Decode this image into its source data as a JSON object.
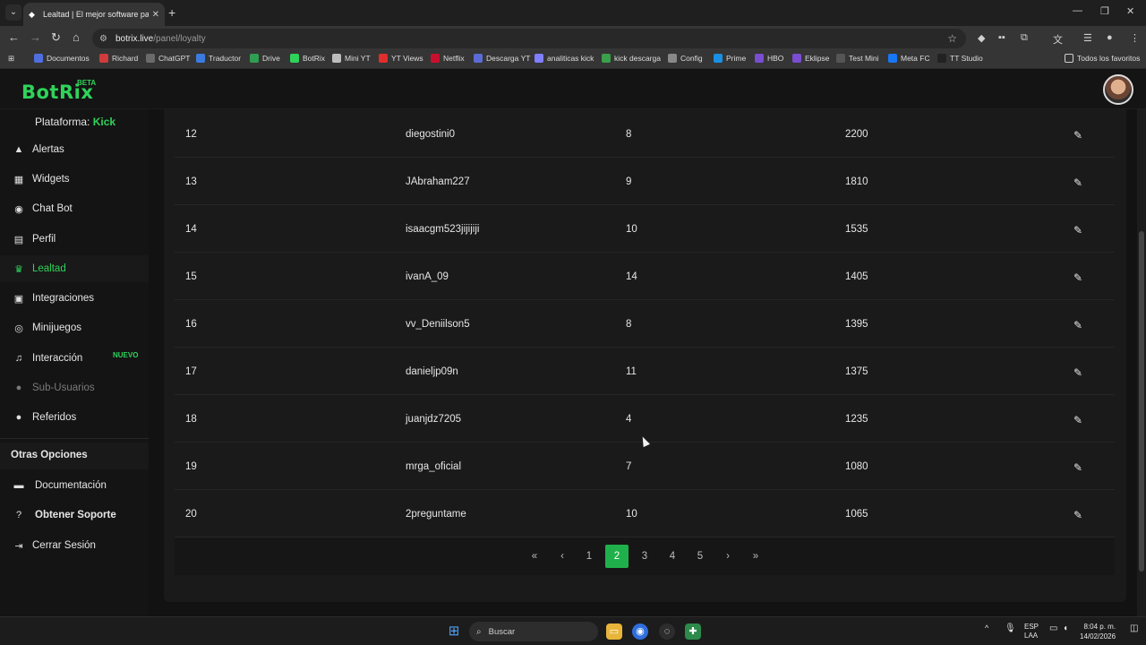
{
  "browser": {
    "tab_title": "Lealtad | El mejor software para",
    "url_host": "botrix.live",
    "url_path": "/panel/loyalty",
    "bookmarks": [
      {
        "label": "Documentos",
        "color": "#4f6fe0"
      },
      {
        "label": "Richard",
        "color": "#d13b3b"
      },
      {
        "label": "ChatGPT",
        "color": "#6a6a6a"
      },
      {
        "label": "Traductor",
        "color": "#3b7be0"
      },
      {
        "label": "Drive",
        "color": "#2f9e52"
      },
      {
        "label": "BotRix",
        "color": "#2fd35a"
      },
      {
        "label": "Mini YT",
        "color": "#bdbdbd"
      },
      {
        "label": "YT Views",
        "color": "#e02d2d"
      },
      {
        "label": "Netflix",
        "color": "#c8102e"
      },
      {
        "label": "Descarga YT",
        "color": "#5b6bd6"
      },
      {
        "label": "analiticas kick",
        "color": "#7f7fff"
      },
      {
        "label": "kick descarga",
        "color": "#3aa04a"
      },
      {
        "label": "Config",
        "color": "#888888"
      },
      {
        "label": "Prime",
        "color": "#1a8fe3"
      },
      {
        "label": "HBO",
        "color": "#7a4dd1"
      },
      {
        "label": "Eklipse",
        "color": "#7a4dd1"
      },
      {
        "label": "Test Mini",
        "color": "#555555"
      },
      {
        "label": "Meta FC",
        "color": "#1877f2"
      },
      {
        "label": "TT Studio",
        "color": "#222222"
      }
    ],
    "all_bookmarks_label": "Todos los favoritos"
  },
  "app": {
    "logo": "BotRix",
    "logo_beta": "BETA",
    "accent": "#2fd35a"
  },
  "sidebar": {
    "platform_label": "Plataforma:",
    "platform_value": "Kick",
    "items": [
      {
        "label": "Alertas",
        "icon": "warning-icon"
      },
      {
        "label": "Widgets",
        "icon": "grid-icon"
      },
      {
        "label": "Chat Bot",
        "icon": "robot-icon"
      },
      {
        "label": "Perfil",
        "icon": "id-card-icon"
      },
      {
        "label": "Lealtad",
        "icon": "trophy-icon"
      },
      {
        "label": "Integraciones",
        "icon": "cube-icon"
      },
      {
        "label": "Minijuegos",
        "icon": "gamepad-icon"
      },
      {
        "label": "Interacción",
        "icon": "music-icon"
      },
      {
        "label": "Sub-Usuarios",
        "icon": "users-icon"
      },
      {
        "label": "Referidos",
        "icon": "user-group-icon"
      }
    ],
    "nuevo_badge": "NUEVO",
    "other_section": "Otras Opciones",
    "other_items": [
      {
        "label": "Documentación",
        "icon": "scroll-icon"
      },
      {
        "label": "Obtener Soporte",
        "icon": "question-icon"
      },
      {
        "label": "Cerrar Sesión",
        "icon": "sign-out-icon"
      }
    ]
  },
  "table": {
    "rows": [
      {
        "rank": "12",
        "user": "diegostini0",
        "level": "8",
        "points": "2200"
      },
      {
        "rank": "13",
        "user": "JAbraham227",
        "level": "9",
        "points": "1810"
      },
      {
        "rank": "14",
        "user": "isaacgm523jijijiji",
        "level": "10",
        "points": "1535"
      },
      {
        "rank": "15",
        "user": "ivanA_09",
        "level": "14",
        "points": "1405"
      },
      {
        "rank": "16",
        "user": "vv_Deniilson5",
        "level": "8",
        "points": "1395"
      },
      {
        "rank": "17",
        "user": "danieljp09n",
        "level": "11",
        "points": "1375"
      },
      {
        "rank": "18",
        "user": "juanjdz7205",
        "level": "4",
        "points": "1235"
      },
      {
        "rank": "19",
        "user": "mrga_oficial",
        "level": "7",
        "points": "1080"
      },
      {
        "rank": "20",
        "user": "2preguntame",
        "level": "10",
        "points": "1065"
      }
    ]
  },
  "pagination": {
    "first": "«",
    "prev": "‹",
    "pages": [
      "1",
      "2",
      "3",
      "4",
      "5"
    ],
    "active": "2",
    "next": "›",
    "last": "»"
  },
  "taskbar": {
    "search_placeholder": "Buscar",
    "lang_top": "ESP",
    "lang_bottom": "LAA",
    "time": "8:04 p. m.",
    "date": "14/02/2026"
  }
}
